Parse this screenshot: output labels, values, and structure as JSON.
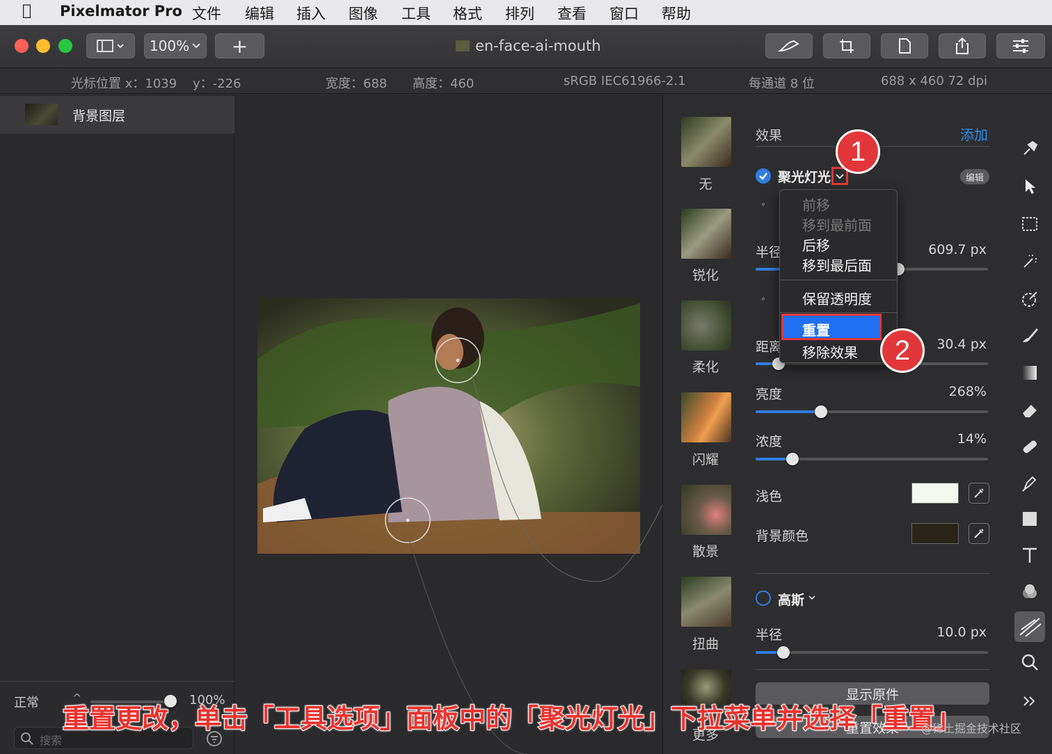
{
  "menubar": {
    "app_name": "Pixelmator Pro",
    "items": [
      "文件",
      "编辑",
      "插入",
      "图像",
      "工具",
      "格式",
      "排列",
      "查看",
      "窗口",
      "帮助"
    ]
  },
  "toolbar": {
    "zoom": "100%",
    "add_label": "+",
    "document_title": "en-face-ai-mouth"
  },
  "infobar": {
    "cursor_x": "光标位置 x：1039",
    "cursor_y": "y：-226",
    "width": "宽度：688",
    "height": "高度：460",
    "color_profile": "sRGB IEC61966-2.1",
    "bit_depth": "每通道 8 位",
    "dimensions": "688 x 460 72 dpi"
  },
  "layers": {
    "items": [
      {
        "name": "背景图层"
      }
    ],
    "blend_mode": "正常",
    "opacity": "100%",
    "search_placeholder": "搜索"
  },
  "effects_browser": {
    "items": [
      "无",
      "锐化",
      "柔化",
      "闪耀",
      "散景",
      "扭曲",
      "更多"
    ]
  },
  "options": {
    "section_title": "效果",
    "add_label": "添加",
    "edit_label": "编辑",
    "effect1": {
      "name": "聚光灯光",
      "checked": true
    },
    "radius_label": "半径",
    "radius_value": "609.7 px",
    "distance_label": "距离",
    "distance_value": "30.4 px",
    "brightness": {
      "label": "亮度",
      "value": "268%",
      "level": 0.28
    },
    "density": {
      "label": "浓度",
      "value": "14%",
      "level": 0.16
    },
    "tint_label": "浅色",
    "tint_color": "#f4f8ee",
    "bg_color_label": "背景颜色",
    "bg_color": "#2a2418",
    "effect2": {
      "name": "高斯",
      "checked": false,
      "radius_label": "半径",
      "radius_value": "10.0 px",
      "level": 0.12
    },
    "show_original": "显示原件",
    "reset_effects": "重置效果"
  },
  "dropdown_menu": {
    "items_disabled": [
      "前移",
      "移到最前面"
    ],
    "items": [
      "后移",
      "移到最后面",
      "保留透明度"
    ],
    "highlighted": "重置",
    "last": "移除效果"
  },
  "annotations": {
    "badge1": "1",
    "badge2": "2",
    "caption": "重置更改，单击「工具选项」面板中的「聚光灯光」下拉菜单并选择「重置」",
    "watermark": "@稀土掘金技术社区"
  },
  "colors": {
    "accent": "#2f7de1",
    "highlight": "#1f6ff0",
    "annotation": "#e2373a"
  }
}
